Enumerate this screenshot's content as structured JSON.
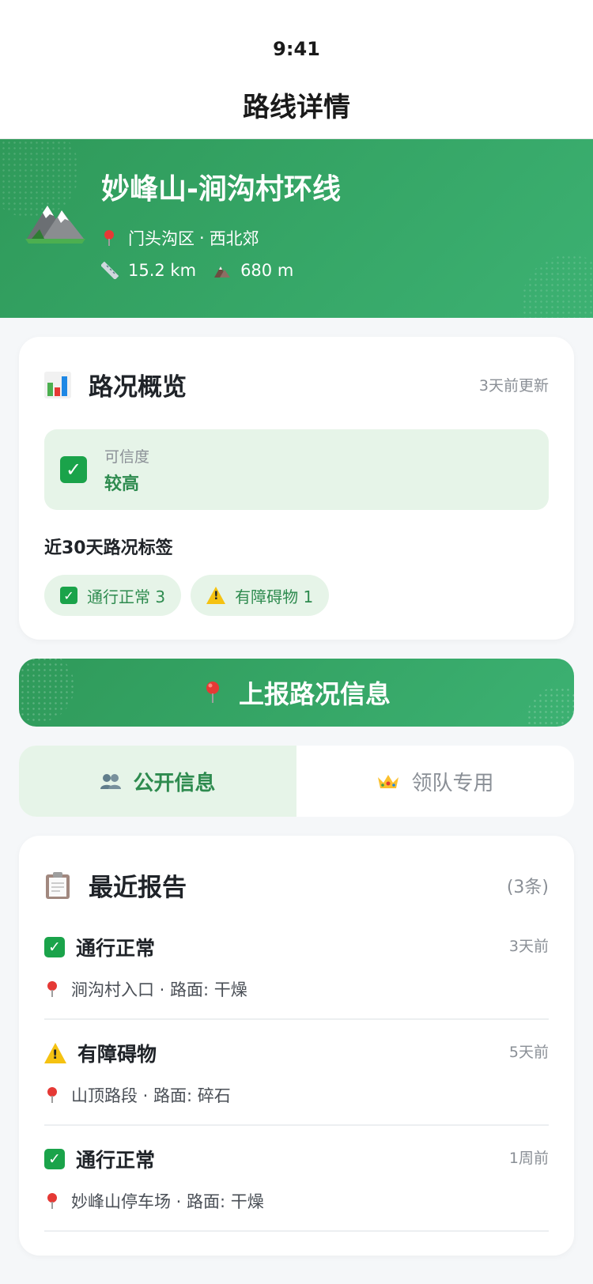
{
  "status_bar": {
    "time": "9:41"
  },
  "nav": {
    "title": "路线详情"
  },
  "hero": {
    "title": "妙峰山-涧沟村环线",
    "location": "门头沟区",
    "location_sep": "·",
    "region": "西北郊",
    "distance": "15.2 km",
    "elevation": "680 m"
  },
  "overview": {
    "title": "路况概览",
    "updated": "3天前更新",
    "trust_label": "可信度",
    "trust_value": "较高",
    "tags_title": "近30天路况标签",
    "tags": [
      {
        "label": "通行正常 3",
        "icon": "check-icon"
      },
      {
        "label": "有障碍物 1",
        "icon": "warning-icon"
      }
    ]
  },
  "report_button": {
    "label": "上报路况信息"
  },
  "tabs": [
    {
      "label": "公开信息",
      "active": true
    },
    {
      "label": "领队专用",
      "active": false
    }
  ],
  "recent": {
    "title": "最近报告",
    "count": "(3条)",
    "items": [
      {
        "status": "通行正常",
        "icon": "check-icon",
        "time": "3天前",
        "place": "涧沟村入口 · 路面: 干燥"
      },
      {
        "status": "有障碍物",
        "icon": "warning-icon",
        "time": "5天前",
        "place": "山顶路段 · 路面: 碎石"
      },
      {
        "status": "通行正常",
        "icon": "check-icon",
        "time": "1周前",
        "place": "妙峰山停车场 · 路面: 干燥"
      }
    ]
  },
  "colors": {
    "brand_green": "#3cb172",
    "brand_green_dark": "#2f9a5a",
    "success_bg": "#e6f4e8",
    "success_text": "#2e8b4f",
    "warning": "#f5c211"
  }
}
